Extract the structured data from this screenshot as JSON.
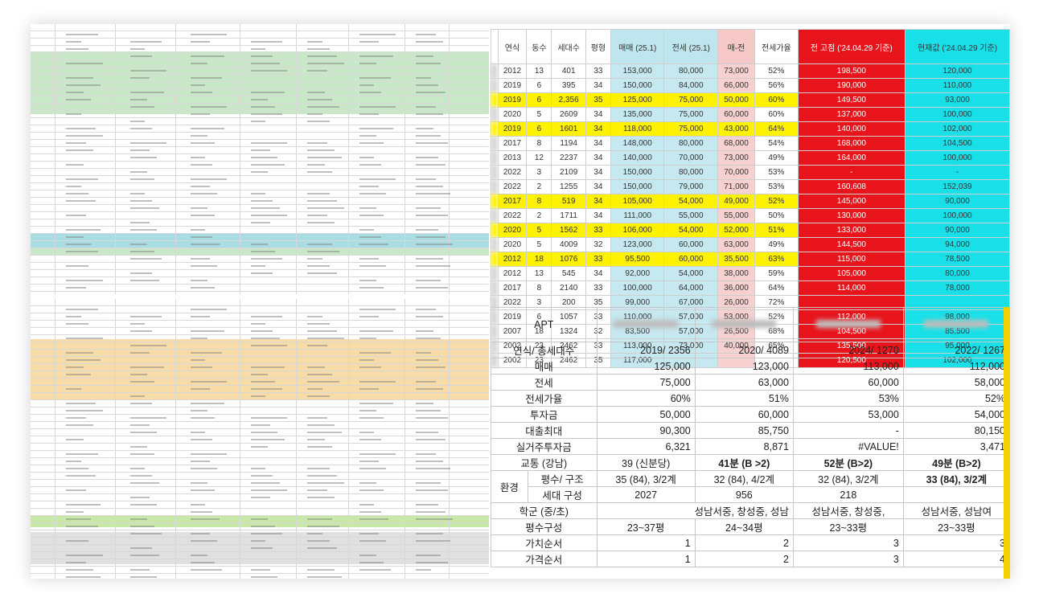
{
  "colors": {
    "yellow": "#fff200",
    "light_blue": "#c6e8f0",
    "pink": "#f7d0d0",
    "red": "#e8141c",
    "cyan": "#19e0e8",
    "green_band": "#bfe6c0",
    "orange_band": "#f8dca8"
  },
  "price_table": {
    "headers": [
      "연식",
      "동수",
      "세대수",
      "평형",
      "매매 (25.1)",
      "전세 (25.1)",
      "매-전",
      "전세가율",
      "전 고점 ('24.04.29 기준)",
      "현재값 ('24.04.29 기준)"
    ],
    "rows": [
      {
        "y": "2012",
        "d": "13",
        "h": "401",
        "p": "33",
        "m": "153,000",
        "j": "80,000",
        "g": "73,000",
        "r": "52%",
        "hi": "198,500",
        "cur": "120,000",
        "yellow": false
      },
      {
        "y": "2019",
        "d": "6",
        "h": "395",
        "p": "34",
        "m": "150,000",
        "j": "84,000",
        "g": "66,000",
        "r": "56%",
        "hi": "190,000",
        "cur": "110,000",
        "yellow": false
      },
      {
        "y": "2019",
        "d": "6",
        "h": "2,356",
        "p": "35",
        "m": "125,000",
        "j": "75,000",
        "g": "50,000",
        "r": "60%",
        "hi": "149,500",
        "cur": "93,000",
        "yellow": true
      },
      {
        "y": "2020",
        "d": "5",
        "h": "2609",
        "p": "34",
        "m": "135,000",
        "j": "75,000",
        "g": "60,000",
        "r": "60%",
        "hi": "137,000",
        "cur": "100,000",
        "yellow": false
      },
      {
        "y": "2019",
        "d": "6",
        "h": "1601",
        "p": "34",
        "m": "118,000",
        "j": "75,000",
        "g": "43,000",
        "r": "64%",
        "hi": "140,000",
        "cur": "102,000",
        "yellow": true
      },
      {
        "y": "2017",
        "d": "8",
        "h": "1194",
        "p": "34",
        "m": "148,000",
        "j": "80,000",
        "g": "68,000",
        "r": "54%",
        "hi": "168,000",
        "cur": "104,500",
        "yellow": false
      },
      {
        "y": "2013",
        "d": "12",
        "h": "2237",
        "p": "34",
        "m": "140,000",
        "j": "70,000",
        "g": "73,000",
        "r": "49%",
        "hi": "164,000",
        "cur": "100,000",
        "yellow": false
      },
      {
        "y": "2022",
        "d": "3",
        "h": "2109",
        "p": "34",
        "m": "150,000",
        "j": "80,000",
        "g": "70,000",
        "r": "53%",
        "hi": "-",
        "cur": "-",
        "yellow": false
      },
      {
        "y": "2022",
        "d": "2",
        "h": "1255",
        "p": "34",
        "m": "150,000",
        "j": "79,000",
        "g": "71,000",
        "r": "53%",
        "hi": "160,608",
        "cur": "152,039",
        "yellow": false
      },
      {
        "y": "2017",
        "d": "8",
        "h": "519",
        "p": "34",
        "m": "105,000",
        "j": "54,000",
        "g": "49,000",
        "r": "52%",
        "hi": "145,000",
        "cur": "90,000",
        "yellow": true
      },
      {
        "y": "2022",
        "d": "2",
        "h": "1711",
        "p": "34",
        "m": "111,000",
        "j": "55,000",
        "g": "55,000",
        "r": "50%",
        "hi": "130,000",
        "cur": "100,000",
        "yellow": false
      },
      {
        "y": "2020",
        "d": "5",
        "h": "1562",
        "p": "33",
        "m": "106,000",
        "j": "54,000",
        "g": "52,000",
        "r": "51%",
        "hi": "133,000",
        "cur": "90,000",
        "yellow": true
      },
      {
        "y": "2020",
        "d": "5",
        "h": "4009",
        "p": "32",
        "m": "123,000",
        "j": "60,000",
        "g": "63,000",
        "r": "49%",
        "hi": "144,500",
        "cur": "94,000",
        "yellow": false
      },
      {
        "y": "2012",
        "d": "18",
        "h": "1076",
        "p": "33",
        "m": "95,500",
        "j": "60,000",
        "g": "35,500",
        "r": "63%",
        "hi": "115,000",
        "cur": "78,500",
        "yellow": true
      },
      {
        "y": "2012",
        "d": "13",
        "h": "545",
        "p": "34",
        "m": "92,000",
        "j": "54,000",
        "g": "38,000",
        "r": "59%",
        "hi": "105,000",
        "cur": "80,000",
        "yellow": false
      },
      {
        "y": "2017",
        "d": "8",
        "h": "2140",
        "p": "33",
        "m": "100,000",
        "j": "64,000",
        "g": "36,000",
        "r": "64%",
        "hi": "114,000",
        "cur": "78,000",
        "yellow": false
      },
      {
        "y": "2022",
        "d": "3",
        "h": "200",
        "p": "35",
        "m": "99,000",
        "j": "67,000",
        "g": "26,000",
        "r": "72%",
        "hi": "",
        "cur": "",
        "yellow": false
      },
      {
        "y": "2019",
        "d": "6",
        "h": "1057",
        "p": "33",
        "m": "110,000",
        "j": "57,000",
        "g": "53,000",
        "r": "52%",
        "hi": "112,000",
        "cur": "98,000",
        "yellow": false
      },
      {
        "y": "2007",
        "d": "18",
        "h": "1324",
        "p": "32",
        "m": "83,500",
        "j": "57,000",
        "g": "26,500",
        "r": "68%",
        "hi": "104,500",
        "cur": "85,500",
        "yellow": false
      },
      {
        "y": "2002",
        "d": "23",
        "h": "2462",
        "p": "33",
        "m": "113,000",
        "j": "73,000",
        "g": "40,000",
        "r": "65%",
        "hi": "135,500",
        "cur": "95,000",
        "yellow": false
      },
      {
        "y": "2002",
        "d": "23",
        "h": "2462",
        "p": "35",
        "m": "117,000",
        "j": "",
        "g": "",
        "r": "",
        "hi": "120,500",
        "cur": "102,000",
        "yellow": false
      }
    ]
  },
  "compare_table": {
    "apt_label": "APT",
    "rows": [
      {
        "label": "연식/ 총세대수",
        "v": [
          "2019/ 2356",
          "2020/ 4089",
          "2024/ 1270",
          "2022/ 1267"
        ]
      },
      {
        "label": "매매",
        "v": [
          "125,000",
          "123,000",
          "113,000",
          "112,000"
        ]
      },
      {
        "label": "전세",
        "v": [
          "75,000",
          "63,000",
          "60,000",
          "58,000"
        ]
      },
      {
        "label": "전세가율",
        "v": [
          "60%",
          "51%",
          "53%",
          "52%"
        ]
      },
      {
        "label": "투자금",
        "v": [
          "50,000",
          "60,000",
          "53,000",
          "54,000"
        ]
      },
      {
        "label": "대출최대",
        "v": [
          "90,300",
          "85,750",
          "-",
          "80,150"
        ]
      },
      {
        "label": "실거주투자금",
        "v": [
          "6,321",
          "8,871",
          "#VALUE!",
          "3,471"
        ]
      },
      {
        "label": "교통 (강남)",
        "v": [
          "39 (신분당)",
          "41분 (B >2)",
          "52분 (B>2)",
          "49분 (B>2)"
        ]
      }
    ],
    "env_label": "환경",
    "env_rows": [
      {
        "label": "평수/ 구조",
        "v": [
          "35 (84), 3/2계",
          "32 (84), 4/2계",
          "32 (84), 3/2계",
          "33 (84), 3/2계"
        ]
      },
      {
        "label": "세대 구성",
        "v": [
          "2027",
          "956",
          "218",
          ""
        ]
      }
    ],
    "school_label": "학군 (중/초)",
    "school_v": [
      "성남서중, 창성중, 성남",
      "성남서중, 창성중,",
      "성남서중, 성남여"
    ],
    "tail_rows": [
      {
        "label": "평수구성",
        "v": [
          "23~37평",
          "24~34평",
          "23~33평",
          "23~33평"
        ]
      },
      {
        "label": "가치순서",
        "v": [
          "1",
          "2",
          "3",
          "3"
        ]
      },
      {
        "label": "가격순서",
        "v": [
          "1",
          "2",
          "3",
          "4"
        ]
      }
    ]
  }
}
